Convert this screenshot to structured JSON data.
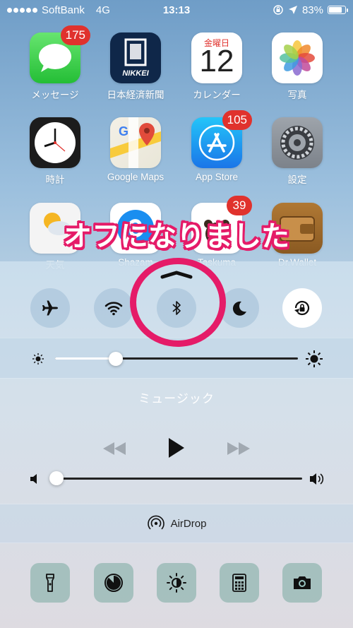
{
  "status_bar": {
    "carrier": "SoftBank",
    "network": "4G",
    "time": "13:13",
    "battery_percent": "83%",
    "battery_level": 0.83
  },
  "apps": [
    {
      "label": "メッセージ",
      "badge": "175",
      "icon": "messages-icon"
    },
    {
      "label": "日本経済新聞",
      "badge": null,
      "icon": "nikkei-icon",
      "icon_text": "NIKKEI"
    },
    {
      "label": "カレンダー",
      "badge": null,
      "icon": "calendar-icon",
      "day": "金曜日",
      "date": "12"
    },
    {
      "label": "写真",
      "badge": null,
      "icon": "photos-icon"
    },
    {
      "label": "時計",
      "badge": null,
      "icon": "clock-icon"
    },
    {
      "label": "Google Maps",
      "badge": null,
      "icon": "google-maps-icon"
    },
    {
      "label": "App Store",
      "badge": "105",
      "icon": "app-store-icon"
    },
    {
      "label": "設定",
      "badge": null,
      "icon": "settings-icon"
    },
    {
      "label": "天気",
      "badge": null,
      "icon": "weather-icon"
    },
    {
      "label": "Shazam",
      "badge": null,
      "icon": "shazam-icon"
    },
    {
      "label": "Taskuma",
      "badge": "39",
      "icon": "taskuma-icon"
    },
    {
      "label": "Dr.Wallet",
      "badge": null,
      "icon": "dr-wallet-icon"
    }
  ],
  "caption": "オフになりました",
  "control_center": {
    "toggles": [
      {
        "name": "airplane-mode",
        "icon": "airplane-icon",
        "active": false
      },
      {
        "name": "wifi",
        "icon": "wifi-icon",
        "active": false
      },
      {
        "name": "bluetooth",
        "icon": "bluetooth-icon",
        "active": false
      },
      {
        "name": "do-not-disturb",
        "icon": "moon-icon",
        "active": false
      },
      {
        "name": "rotation-lock",
        "icon": "rotation-lock-icon",
        "active": true
      }
    ],
    "brightness_level": 0.25,
    "music_label": "ミュージック",
    "volume_level": 0.0,
    "airdrop_label": "AirDrop",
    "shortcuts": [
      {
        "name": "flashlight",
        "icon": "flashlight-icon"
      },
      {
        "name": "timer",
        "icon": "timer-icon"
      },
      {
        "name": "night-shift",
        "icon": "night-shift-icon"
      },
      {
        "name": "calculator",
        "icon": "calculator-icon"
      },
      {
        "name": "camera",
        "icon": "camera-icon"
      }
    ]
  },
  "colors": {
    "accent": "#e51b68",
    "badge": "#e0322d"
  }
}
